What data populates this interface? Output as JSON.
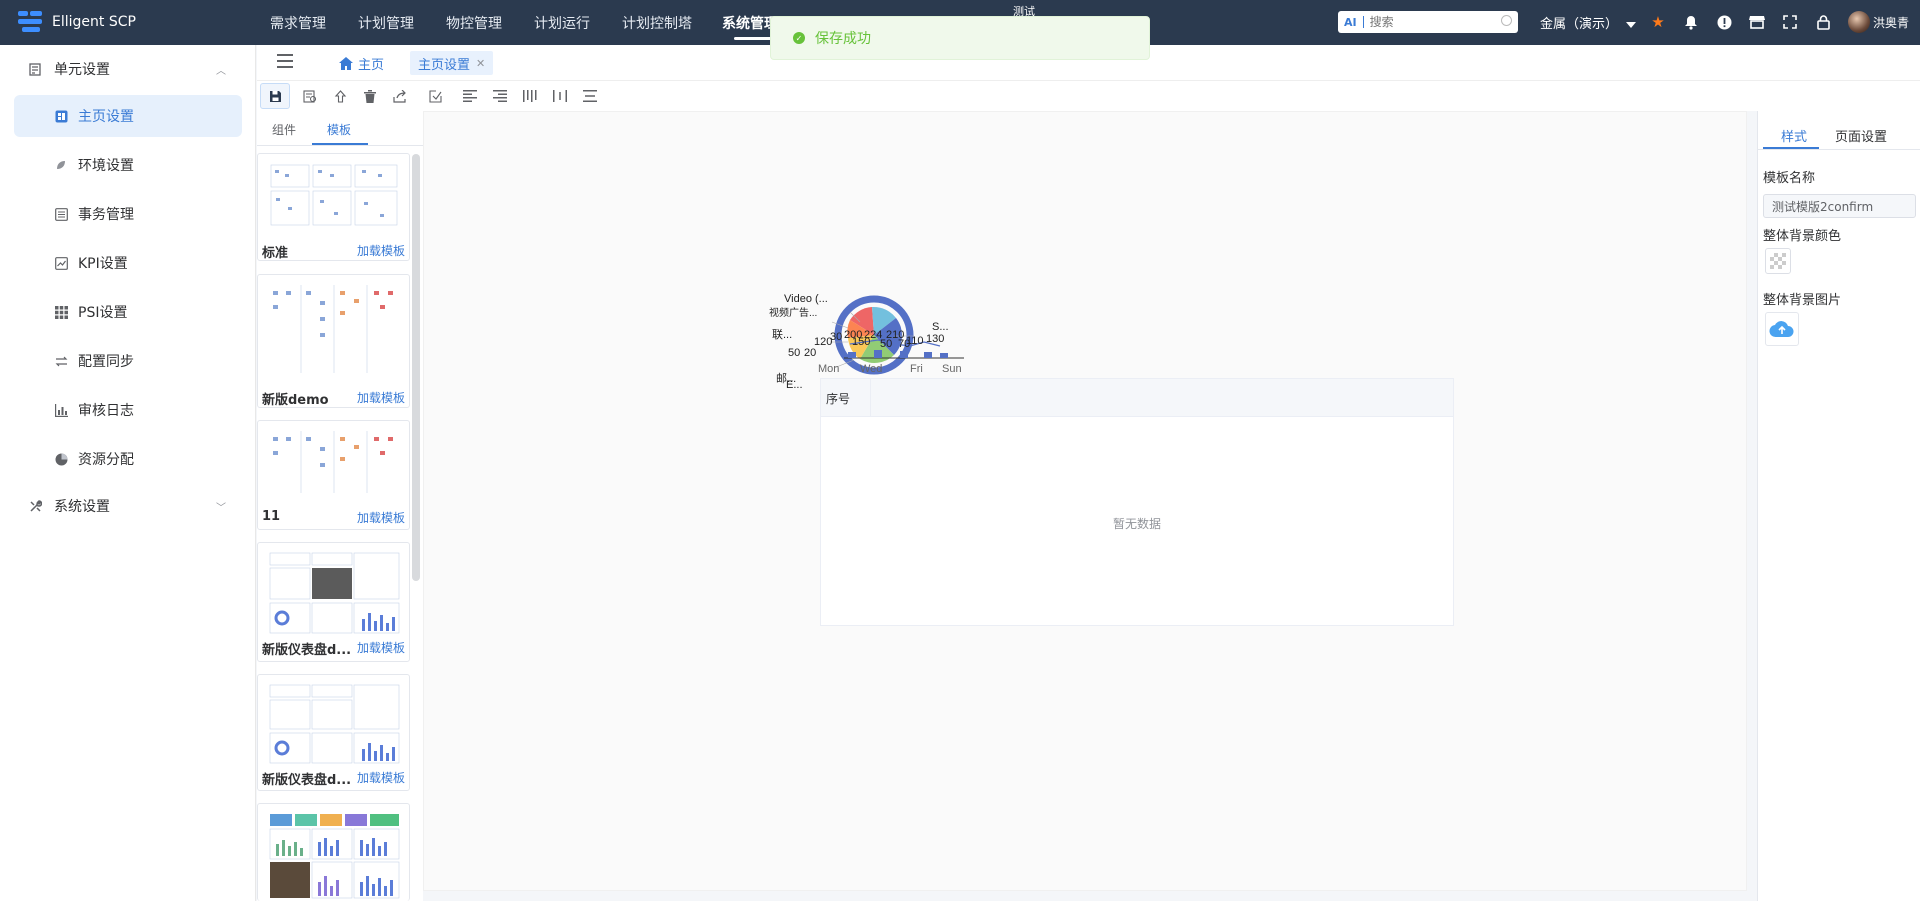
{
  "app": {
    "name": "Elligent SCP"
  },
  "nav": {
    "items": [
      "需求管理",
      "计划管理",
      "物控管理",
      "计划运行",
      "计划控制塔",
      "系统管理"
    ],
    "active": "系统管理",
    "tooltip": "测试"
  },
  "search": {
    "ai_label": "AI",
    "placeholder": "搜索"
  },
  "org": {
    "label": "金属（演示）"
  },
  "user": {
    "name": "洪奥青"
  },
  "toast": {
    "message": "保存成功",
    "type": "success",
    "color": "#67c23a"
  },
  "sidebar": {
    "group1": {
      "label": "单元设置",
      "icon": "unit-icon"
    },
    "items": [
      {
        "label": "主页设置",
        "icon": "home-settings-icon",
        "active": true
      },
      {
        "label": "环境设置",
        "icon": "environment-icon"
      },
      {
        "label": "事务管理",
        "icon": "transaction-list-icon"
      },
      {
        "label": "KPI设置",
        "icon": "kpi-chart-icon"
      },
      {
        "label": "PSI设置",
        "icon": "psi-grid-icon"
      },
      {
        "label": "配置同步",
        "icon": "sync-arrows-icon"
      },
      {
        "label": "审核日志",
        "icon": "audit-bar-icon"
      },
      {
        "label": "资源分配",
        "icon": "pie-icon"
      }
    ],
    "group2": {
      "label": "系统设置",
      "icon": "tools-icon"
    }
  },
  "tabs": [
    {
      "label": "主页",
      "icon": "home-icon"
    },
    {
      "label": "主页设置",
      "active": true
    }
  ],
  "toolbar": {
    "buttons": [
      "save-icon",
      "preview-icon",
      "publish-icon",
      "delete-icon",
      "share-icon",
      "check-icon",
      "align-left-icon",
      "align-right-icon",
      "distribute-horizontal-icon",
      "align-center-icon",
      "distribute-vertical-icon"
    ]
  },
  "left_panel": {
    "tabs": [
      "组件",
      "模板"
    ],
    "active_tab": "模板",
    "load_label": "加载模板",
    "templates": [
      {
        "name": "标准"
      },
      {
        "name": "新版demo"
      },
      {
        "name": "11"
      },
      {
        "name": "新版仪表盘d..."
      },
      {
        "name": "新版仪表盘d..."
      },
      {
        "name": ""
      }
    ]
  },
  "canvas": {
    "chart_labels": [
      "Video (...",
      "视频广告...",
      "联...",
      "120",
      "30",
      "200",
      "224",
      "210",
      "110",
      "130",
      "50",
      "20",
      "150",
      "50",
      "70",
      "Mon",
      "Wed",
      "Fri",
      "Sun",
      "S...",
      "E...",
      "邮..."
    ],
    "grid": {
      "header": "序号",
      "empty_text": "暂无数据"
    }
  },
  "right_panel": {
    "tabs": [
      "样式",
      "页面设置"
    ],
    "active_tab": "样式",
    "template_name_label": "模板名称",
    "template_name_value": "测试模版2confirm",
    "bg_color_label": "整体背景颜色",
    "bg_image_label": "整体背景图片"
  },
  "colors": {
    "accent": "#3a7bd5",
    "topbar": "#2b3a4f",
    "success": "#67c23a"
  }
}
